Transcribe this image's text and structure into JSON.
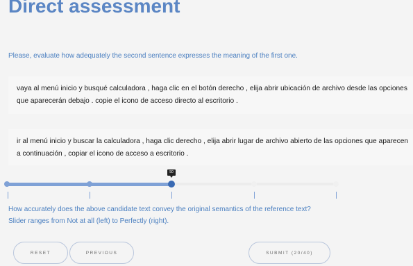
{
  "header": {
    "title": "Direct assessment"
  },
  "instruction": "Please, evaluate how adequately the second sentence expresses the meaning of the first one.",
  "reference_text": "vaya al menú inicio y busqué calculadora , haga clic en el botón derecho , elija abrir ubicación de archivo desde las opciones que aparecerán debajo . copie el icono de acceso directo al escritorio .",
  "candidate_text": "ir al menú inicio y buscar la calculadora , haga clic derecho , elija abrir lugar de archivo abierto de las opciones que aparecen a continuación , copiar el icono de acceso a escritorio .",
  "slider": {
    "value": 50,
    "min": 0,
    "max": 100,
    "tooltip": "50"
  },
  "question": {
    "line1": "How accurately does the above candidate text convey the original semantics of the reference text?",
    "line2": "Slider ranges from Not at all (left) to Perfectly (right)."
  },
  "buttons": {
    "reset": "RESET",
    "previous": "PREVIOUS",
    "submit": "SUBMIT (20/40)"
  },
  "colors": {
    "accent": "#5b86c4",
    "slider_fill": "#7fa1d6",
    "slider_handle": "#3a6ab3"
  }
}
